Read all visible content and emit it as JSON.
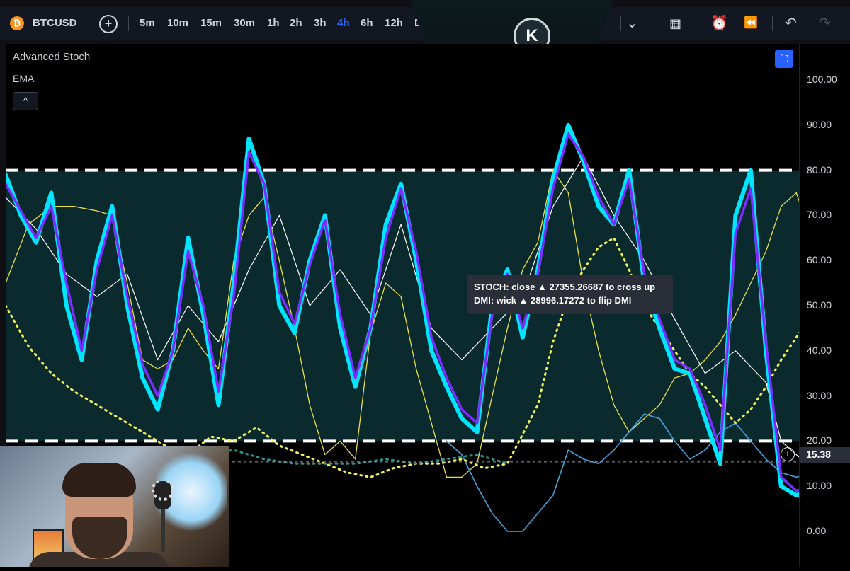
{
  "toolbar": {
    "symbol": "BTCUSD",
    "symbol_icon": "bitcoin-icon",
    "intervals": [
      "5m",
      "10m",
      "15m",
      "30m",
      "1h",
      "2h",
      "3h",
      "4h",
      "6h",
      "12h",
      "D"
    ],
    "active_interval": "4h",
    "logo_letter": "K"
  },
  "indicator": {
    "name": "Advanced Stoch",
    "sub": "EMA",
    "collapse_glyph": "^"
  },
  "price_axis": {
    "labels": [
      "100.00",
      "90.00",
      "80.00",
      "70.00",
      "60.00",
      "50.00",
      "40.00",
      "30.00",
      "20.00",
      "10.00",
      "0.00"
    ],
    "current_value": "15.38"
  },
  "tooltip": {
    "line1": "STOCH: close ▲ 27355.26687 to cross up",
    "line2": "DMI: wick ▲ 28996.17272 to flip DMI"
  },
  "colors": {
    "stoch_k": "#00e5ff",
    "stoch_d": "#7b2cff",
    "ema": "#ffffff",
    "yellow": "#e8e04a",
    "dmi_minus": "#4aa3df",
    "dotted_yellow": "#f2f25a",
    "dotted_teal": "#2f8f8a",
    "band": "#0b2a2e",
    "accent": "#2962ff"
  },
  "chart_data": {
    "type": "line",
    "ylim": [
      -8,
      108
    ],
    "levels": [
      80,
      20
    ],
    "crosshair": {
      "x": 106,
      "y": 15.38
    },
    "series": [
      {
        "values": [
          [
            0,
            79
          ],
          [
            2,
            70
          ],
          [
            4,
            64
          ],
          [
            6,
            75
          ],
          [
            8,
            50
          ],
          [
            10,
            38
          ],
          [
            12,
            60
          ],
          [
            14,
            72
          ],
          [
            16,
            50
          ],
          [
            18,
            34
          ],
          [
            20,
            27
          ],
          [
            22,
            40
          ],
          [
            24,
            65
          ],
          [
            26,
            48
          ],
          [
            28,
            28
          ],
          [
            30,
            55
          ],
          [
            32,
            87
          ],
          [
            34,
            77
          ],
          [
            36,
            50
          ],
          [
            38,
            44
          ],
          [
            40,
            60
          ],
          [
            42,
            70
          ],
          [
            44,
            45
          ],
          [
            46,
            32
          ],
          [
            48,
            45
          ],
          [
            50,
            68
          ],
          [
            52,
            77
          ],
          [
            54,
            60
          ],
          [
            56,
            40
          ],
          [
            58,
            32
          ],
          [
            60,
            25
          ],
          [
            62,
            22
          ],
          [
            64,
            50
          ],
          [
            66,
            58
          ],
          [
            68,
            43
          ],
          [
            70,
            58
          ],
          [
            72,
            78
          ],
          [
            74,
            90
          ],
          [
            76,
            82
          ],
          [
            78,
            72
          ],
          [
            80,
            68
          ],
          [
            82,
            80
          ],
          [
            84,
            55
          ],
          [
            86,
            45
          ],
          [
            88,
            36
          ],
          [
            90,
            35
          ],
          [
            92,
            25
          ],
          [
            94,
            15
          ],
          [
            96,
            70
          ],
          [
            98,
            80
          ],
          [
            100,
            40
          ],
          [
            102,
            10
          ],
          [
            104,
            8
          ],
          [
            106,
            9
          ],
          [
            108,
            8
          ]
        ]
      },
      {
        "values": [
          [
            0,
            77
          ],
          [
            2,
            71
          ],
          [
            4,
            65
          ],
          [
            6,
            72
          ],
          [
            8,
            55
          ],
          [
            10,
            40
          ],
          [
            12,
            58
          ],
          [
            14,
            70
          ],
          [
            16,
            52
          ],
          [
            18,
            37
          ],
          [
            20,
            30
          ],
          [
            22,
            40
          ],
          [
            24,
            62
          ],
          [
            26,
            50
          ],
          [
            28,
            31
          ],
          [
            30,
            52
          ],
          [
            32,
            84
          ],
          [
            34,
            77
          ],
          [
            36,
            53
          ],
          [
            38,
            46
          ],
          [
            40,
            59
          ],
          [
            42,
            69
          ],
          [
            44,
            48
          ],
          [
            46,
            34
          ],
          [
            48,
            45
          ],
          [
            50,
            65
          ],
          [
            52,
            76
          ],
          [
            54,
            62
          ],
          [
            56,
            43
          ],
          [
            58,
            34
          ],
          [
            60,
            27
          ],
          [
            62,
            24
          ],
          [
            64,
            48
          ],
          [
            66,
            57
          ],
          [
            68,
            45
          ],
          [
            70,
            57
          ],
          [
            72,
            76
          ],
          [
            74,
            88
          ],
          [
            76,
            83
          ],
          [
            78,
            74
          ],
          [
            80,
            68
          ],
          [
            82,
            78
          ],
          [
            84,
            57
          ],
          [
            86,
            47
          ],
          [
            88,
            38
          ],
          [
            90,
            36
          ],
          [
            92,
            28
          ],
          [
            94,
            18
          ],
          [
            96,
            66
          ],
          [
            98,
            76
          ],
          [
            100,
            42
          ],
          [
            102,
            12
          ],
          [
            104,
            9
          ],
          [
            106,
            10
          ],
          [
            108,
            9
          ]
        ]
      },
      {
        "values": [
          [
            0,
            74
          ],
          [
            4,
            67
          ],
          [
            8,
            57
          ],
          [
            12,
            52
          ],
          [
            16,
            57
          ],
          [
            20,
            38
          ],
          [
            24,
            50
          ],
          [
            28,
            42
          ],
          [
            32,
            58
          ],
          [
            36,
            70
          ],
          [
            40,
            50
          ],
          [
            44,
            58
          ],
          [
            48,
            48
          ],
          [
            52,
            68
          ],
          [
            56,
            45
          ],
          [
            60,
            38
          ],
          [
            64,
            45
          ],
          [
            68,
            52
          ],
          [
            72,
            72
          ],
          [
            76,
            83
          ],
          [
            80,
            70
          ],
          [
            84,
            60
          ],
          [
            88,
            47
          ],
          [
            92,
            35
          ],
          [
            96,
            40
          ],
          [
            100,
            33
          ],
          [
            102,
            20
          ],
          [
            106,
            14
          ]
        ]
      },
      {
        "values": [
          [
            0,
            55
          ],
          [
            3,
            68
          ],
          [
            6,
            72
          ],
          [
            9,
            72
          ],
          [
            12,
            71
          ],
          [
            14,
            70
          ],
          [
            16,
            55
          ],
          [
            18,
            38
          ],
          [
            20,
            36
          ],
          [
            22,
            38
          ],
          [
            24,
            45
          ],
          [
            26,
            40
          ],
          [
            28,
            36
          ],
          [
            30,
            60
          ],
          [
            32,
            70
          ],
          [
            34,
            74
          ],
          [
            36,
            60
          ],
          [
            38,
            45
          ],
          [
            40,
            28
          ],
          [
            42,
            17
          ],
          [
            44,
            20
          ],
          [
            46,
            16
          ],
          [
            48,
            44
          ],
          [
            50,
            55
          ],
          [
            52,
            52
          ],
          [
            54,
            36
          ],
          [
            56,
            24
          ],
          [
            58,
            12
          ],
          [
            60,
            12
          ],
          [
            62,
            15
          ],
          [
            64,
            30
          ],
          [
            66,
            45
          ],
          [
            68,
            58
          ],
          [
            70,
            64
          ],
          [
            72,
            80
          ],
          [
            74,
            75
          ],
          [
            76,
            55
          ],
          [
            78,
            40
          ],
          [
            80,
            28
          ],
          [
            82,
            22
          ],
          [
            84,
            25
          ],
          [
            86,
            28
          ],
          [
            88,
            34
          ],
          [
            90,
            35
          ],
          [
            92,
            38
          ],
          [
            94,
            42
          ],
          [
            96,
            48
          ],
          [
            98,
            55
          ],
          [
            100,
            62
          ],
          [
            102,
            72
          ],
          [
            104,
            75
          ],
          [
            106,
            65
          ]
        ]
      },
      {
        "values": [
          [
            58,
            20
          ],
          [
            60,
            17
          ],
          [
            62,
            10
          ],
          [
            64,
            4
          ],
          [
            66,
            0
          ],
          [
            68,
            0
          ],
          [
            70,
            4
          ],
          [
            72,
            8
          ],
          [
            74,
            18
          ],
          [
            76,
            16
          ],
          [
            78,
            15
          ],
          [
            80,
            18
          ],
          [
            82,
            22
          ],
          [
            84,
            26
          ],
          [
            86,
            25
          ],
          [
            88,
            20
          ],
          [
            90,
            16
          ],
          [
            92,
            18
          ],
          [
            94,
            22
          ],
          [
            96,
            24
          ],
          [
            98,
            20
          ],
          [
            100,
            16
          ],
          [
            102,
            13
          ],
          [
            104,
            12
          ],
          [
            106,
            13
          ],
          [
            108,
            11
          ]
        ]
      },
      {
        "values": [
          [
            0,
            50
          ],
          [
            3,
            41
          ],
          [
            6,
            35
          ],
          [
            9,
            31
          ],
          [
            12,
            28
          ],
          [
            15,
            25
          ],
          [
            18,
            22
          ],
          [
            21,
            19
          ],
          [
            24,
            17
          ],
          [
            27,
            21
          ],
          [
            30,
            20
          ],
          [
            33,
            23
          ],
          [
            36,
            19
          ],
          [
            39,
            17
          ],
          [
            42,
            15
          ],
          [
            45,
            13
          ],
          [
            48,
            12
          ],
          [
            51,
            14
          ],
          [
            54,
            15
          ],
          [
            57,
            15
          ],
          [
            60,
            16
          ],
          [
            63,
            14
          ],
          [
            66,
            15
          ],
          [
            70,
            28
          ],
          [
            72,
            42
          ],
          [
            74,
            52
          ],
          [
            76,
            58
          ],
          [
            78,
            63
          ],
          [
            80,
            65
          ],
          [
            82,
            58
          ],
          [
            84,
            50
          ],
          [
            86,
            45
          ],
          [
            88,
            40
          ],
          [
            90,
            35
          ],
          [
            92,
            32
          ],
          [
            94,
            28
          ],
          [
            96,
            24
          ],
          [
            98,
            27
          ],
          [
            100,
            32
          ],
          [
            102,
            38
          ],
          [
            104,
            43
          ],
          [
            106,
            48
          ]
        ]
      },
      {
        "values": [
          [
            14,
            18
          ],
          [
            18,
            17
          ],
          [
            22,
            16
          ],
          [
            26,
            17
          ],
          [
            30,
            18
          ],
          [
            34,
            16
          ],
          [
            38,
            15
          ],
          [
            42,
            15
          ],
          [
            46,
            15
          ],
          [
            50,
            16
          ],
          [
            54,
            15
          ],
          [
            58,
            16
          ],
          [
            62,
            17
          ],
          [
            66,
            15
          ]
        ]
      }
    ]
  }
}
